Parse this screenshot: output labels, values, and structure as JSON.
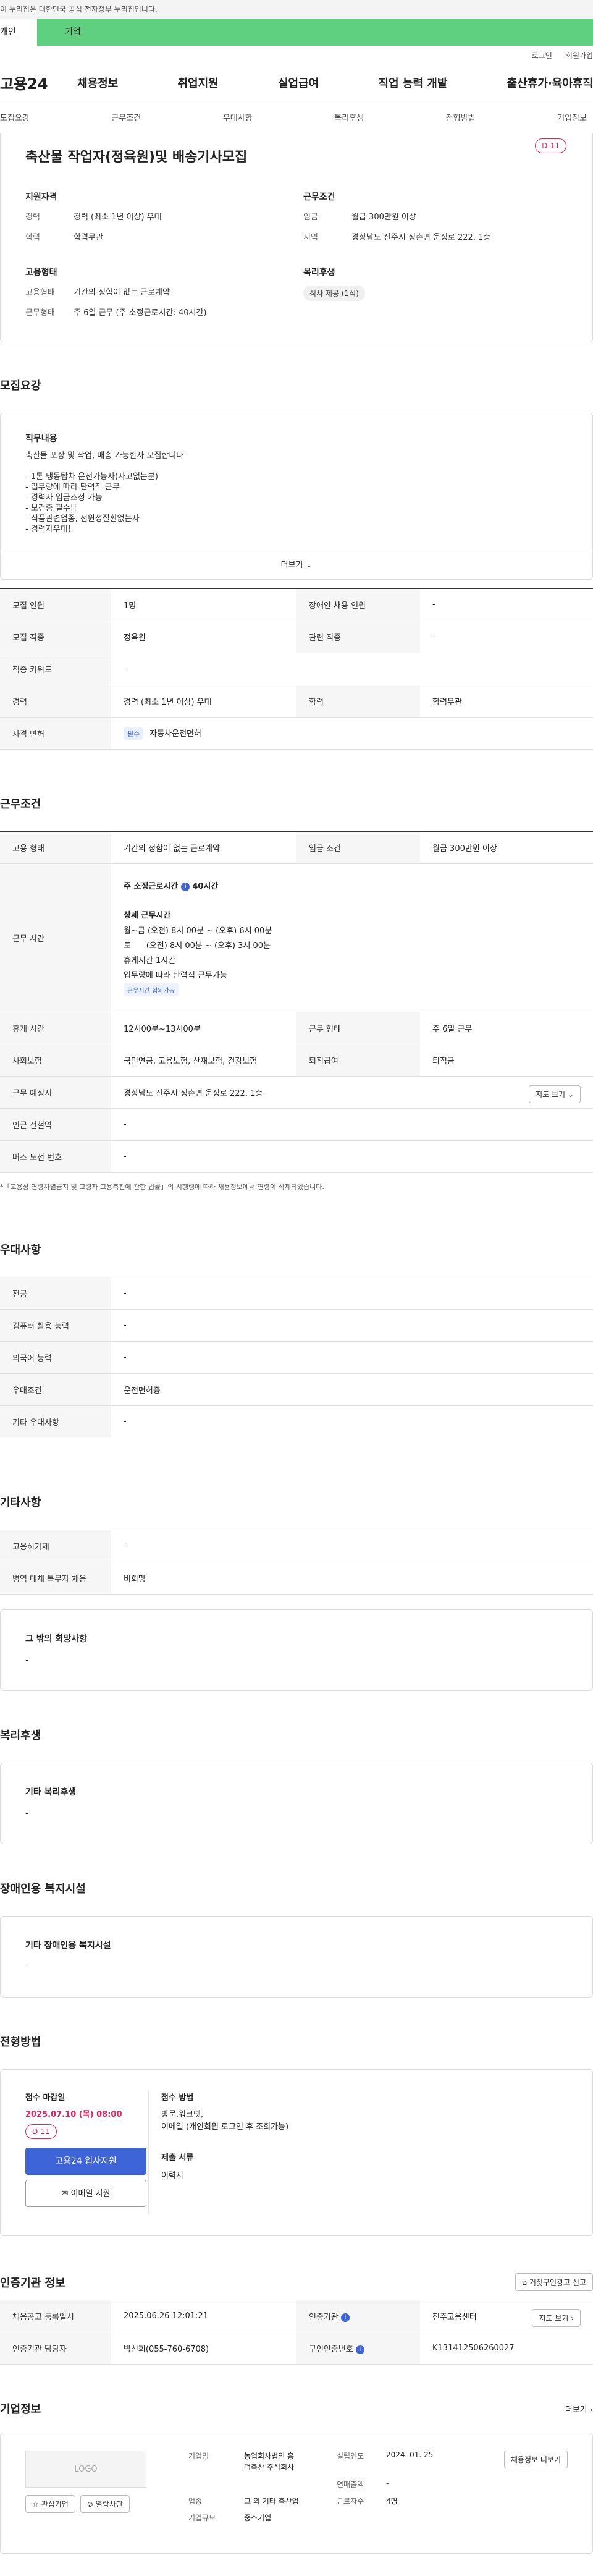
{
  "gov_bar": "이 누리집은 대한민국 공식 전자정부 누리집입니다.",
  "top_tabs": [
    "개인",
    "기업"
  ],
  "util": [
    "로그인",
    "회원가입"
  ],
  "logo": "고용24",
  "gnb": [
    "채용정보",
    "취업지원",
    "실업급여",
    "직업 능력 개발",
    "출산휴가·육아휴직"
  ],
  "subnav": [
    "모집요강",
    "근무조건",
    "우대사항",
    "복리후생",
    "전형방법",
    "기업정보"
  ],
  "summary": {
    "title": "축산물 작업자(정육원)및 배송기사모집",
    "dday": "D-11",
    "qual_title": "지원자격",
    "qual": [
      {
        "k": "경력",
        "v": "경력 (최소 1년 이상) 우대"
      },
      {
        "k": "학력",
        "v": "학력무관"
      }
    ],
    "cond_title": "근무조건",
    "cond": [
      {
        "k": "임금",
        "v": "월급 300만원 이상"
      },
      {
        "k": "지역",
        "v": "경상남도 진주시 정촌면 운정로 222, 1층"
      }
    ],
    "emp_title": "고용형태",
    "emp": [
      {
        "k": "고용형태",
        "v": "기간의 정함이 없는 근로계약"
      },
      {
        "k": "근무형태",
        "v": "주 6일 근무 (주 소정근로시간: 40시간)"
      }
    ],
    "welfare_title": "복리후생",
    "welfare_chip": "식사 제공 (1식)"
  },
  "recruit": {
    "title": "모집요강",
    "duty_title": "직무내용",
    "duty_lines": [
      "축산물 포장 및 작업, 배송 가능한자 모집합니다",
      "",
      "- 1톤 냉동탑차 운전가능자(사고없는분)",
      "- 업무량에 따라 탄력적 근무",
      "- 경력자 임금조정 가능",
      "- 보건증 필수!!",
      "- 식품관련업종, 전원성질환없는자",
      "- 경력자우대!"
    ],
    "more": "더보기",
    "rows": [
      {
        "k1": "모집 인원",
        "v1": "1명",
        "k2": "장애인 채용 인원",
        "v2": "-"
      },
      {
        "k1": "모집 직종",
        "v1": "정육원",
        "k2": "관련 직종",
        "v2": "-"
      },
      {
        "k1": "직종 키워드",
        "v1": "-",
        "k2": "",
        "v2": ""
      },
      {
        "k1": "경력",
        "v1": "경력 (최소 1년 이상) 우대",
        "k2": "학력",
        "v2": "학력무관"
      }
    ],
    "license_k": "자격 면허",
    "license_badge": "필수",
    "license_v": "자동차운전면허"
  },
  "work": {
    "title": "근무조건",
    "emp_k": "고용 형태",
    "emp_v": "기간의 정함이 없는 근로계약",
    "wage_k": "임금 조건",
    "wage_v": "월급 300만원 이상",
    "hours_k": "근무 시간",
    "hours_main": "주 소정근로시간",
    "hours_value": "40시간",
    "hours_detail_title": "상세 근무시간",
    "hours_lines": [
      "월~금 (오전) 8시 00분 ~ (오후) 6시 00분",
      "토      (오전) 8시 00분 ~ (오후) 3시 00분",
      "휴게시간 1시간",
      "업무량에 따라 탄력적 근무가능"
    ],
    "hours_chip": "근무시간 협의가능",
    "break_k": "휴게 시간",
    "break_v": "12시00분~13시00분",
    "shift_k": "근무 형태",
    "shift_v": "주 6일 근무",
    "ins_k": "사회보험",
    "ins_v": "국민연금, 고용보험, 산재보험, 건강보험",
    "retire_k": "퇴직급여",
    "retire_v": "퇴직금",
    "place_k": "근무 예정지",
    "place_v": "경상남도 진주시 정촌면 운정로 222, 1층",
    "map_btn": "지도 보기",
    "subway_k": "인근 전철역",
    "subway_v": "-",
    "bus_k": "버스 노선 번호",
    "bus_v": "-",
    "note": "*「고용상 연령차별금지 및 고령자 고용촉진에 관한 법률」의 시행령에 따라 채용정보에서 연령이 삭제되었습니다."
  },
  "pref": {
    "title": "우대사항",
    "rows": [
      {
        "k": "전공",
        "v": "-"
      },
      {
        "k": "컴퓨터 활용 능력",
        "v": "-"
      },
      {
        "k": "외국어 능력",
        "v": "-"
      },
      {
        "k": "우대조건",
        "v": "운전면허증"
      },
      {
        "k": "기타 우대사항",
        "v": "-"
      }
    ]
  },
  "etc": {
    "title": "기타사항",
    "rows": [
      {
        "k": "고용허가제",
        "v": "-"
      },
      {
        "k": "병역 대체 복무자 채용",
        "v": "비희망"
      }
    ],
    "other_title": "그 밖의 희망사항",
    "other_v": "-"
  },
  "welfare": {
    "title": "복리후생",
    "box_title": "기타 복리후생",
    "box_v": "-"
  },
  "disabled": {
    "title": "장애인용 복지시설",
    "box_title": "기타 장애인용 복지시설",
    "box_v": "-"
  },
  "selection": {
    "title": "전형방법",
    "deadline_title": "접수 마감일",
    "deadline": "2025.07.10 (목) 08:00",
    "dday": "D-11",
    "apply_btn": "고용24 입사지원",
    "email_btn": "이메일 지원",
    "method_title": "접수 방법",
    "method_lines": [
      "방문,워크넷,",
      "이메일 (개인회원 로그인 후 조회가능)"
    ],
    "docs_title": "제출 서류",
    "docs_v": "이력서"
  },
  "cert": {
    "title": "인증기관 정보",
    "report_btn": "거짓구인광고 신고",
    "rows": [
      {
        "k1": "채용공고 등록일시",
        "v1": "2025.06.26 12:01:21",
        "k2": "인증기관",
        "v2": "진주고용센터"
      },
      {
        "k1": "인증기관 담당자",
        "v1": "박선희(055-760-6708)",
        "k2": "구인인증번호",
        "v2": "K131412506260027"
      }
    ],
    "map_btn": "지도 보기"
  },
  "company": {
    "title": "기업정보",
    "more": "더보기",
    "logo_text": "LOGO",
    "fav_btn": "관심기업",
    "block_btn": "열람차단",
    "name_k": "기업명",
    "name_v": [
      "농업회사법인 흥",
      "덕축산 주식회사"
    ],
    "year_k": "설립연도",
    "year_v": "2024. 01. 25",
    "sales_k": "연매출액",
    "sales_v": "-",
    "ind_k": "업종",
    "ind_v": "그 외 기타 축산업",
    "size_k": "기업규모",
    "size_v": "중소기업",
    "emp_k": "근로자수",
    "emp_v": "4명",
    "jobs_btn": "채용정보 더보기"
  }
}
